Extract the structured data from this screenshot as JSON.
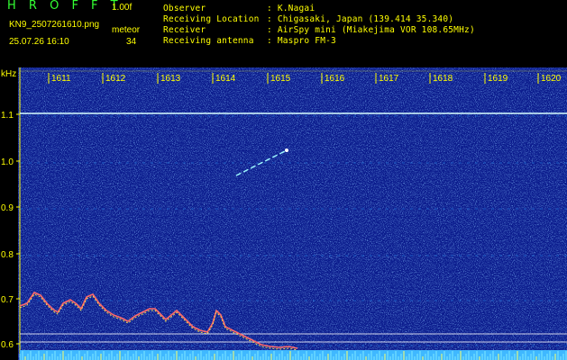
{
  "header": {
    "brand": "H R O F F T",
    "version": "1.00f",
    "filename": "KN9_2507261610.png",
    "meteor_label": "meteor",
    "datetime": "25.07.26 16:10",
    "meteor_count": "34",
    "info_rows": [
      {
        "label": "Observer",
        "value": ": K.Nagai"
      },
      {
        "label": "Receiving Location",
        "value": ": Chigasaki, Japan (139.414 35.340)"
      },
      {
        "label": "Receiver",
        "value": ": AirSpy mini (Miakejima VOR 108.65MHz)"
      },
      {
        "label": "Receiving antenna",
        "value": ": Maspro FM-3"
      }
    ]
  },
  "chart_data": {
    "type": "heatmap",
    "ylabel": "kHz",
    "x_ticks": [
      "1611",
      "1612",
      "1613",
      "1614",
      "1615",
      "1616",
      "1617",
      "1618",
      "1619",
      "1620"
    ],
    "y_ticks": [
      "1.1",
      "1.0",
      "0.9",
      "0.8",
      "0.7",
      "0.6"
    ],
    "grid": true,
    "colors": {
      "background": "#0a1a8c",
      "line": "#d8ffff",
      "axis": "#ffff00",
      "header_text": "#ffff00",
      "brand": "#33ff33"
    }
  }
}
